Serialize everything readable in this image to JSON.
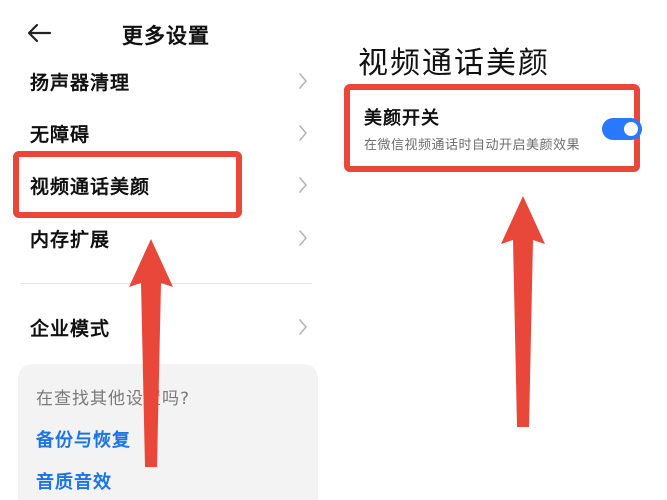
{
  "left_screen": {
    "header": {
      "title": "更多设置",
      "back_icon": "arrow-left-icon"
    },
    "items": [
      {
        "label": "扬声器清理",
        "icon": "chevron-right-icon"
      },
      {
        "label": "无障碍",
        "icon": "chevron-right-icon"
      },
      {
        "label": "视频通话美颜",
        "icon": "chevron-right-icon",
        "highlighted": true
      },
      {
        "label": "内存扩展",
        "icon": "chevron-right-icon"
      },
      {
        "label": "企业模式",
        "icon": "chevron-right-icon"
      }
    ],
    "suggest_card": {
      "title": "在查找其他设置吗?",
      "links": [
        "备份与恢复",
        "音质音效"
      ]
    }
  },
  "right_screen": {
    "title": "视频通话美颜",
    "toggle": {
      "label": "美颜开关",
      "description": "在微信视频通话时自动开启美颜效果",
      "state": "on"
    }
  },
  "colors": {
    "highlight_red": "#e8473a",
    "link_blue": "#1b74e8",
    "toggle_blue": "#2979ff",
    "card_bg": "#f3f3f3"
  }
}
